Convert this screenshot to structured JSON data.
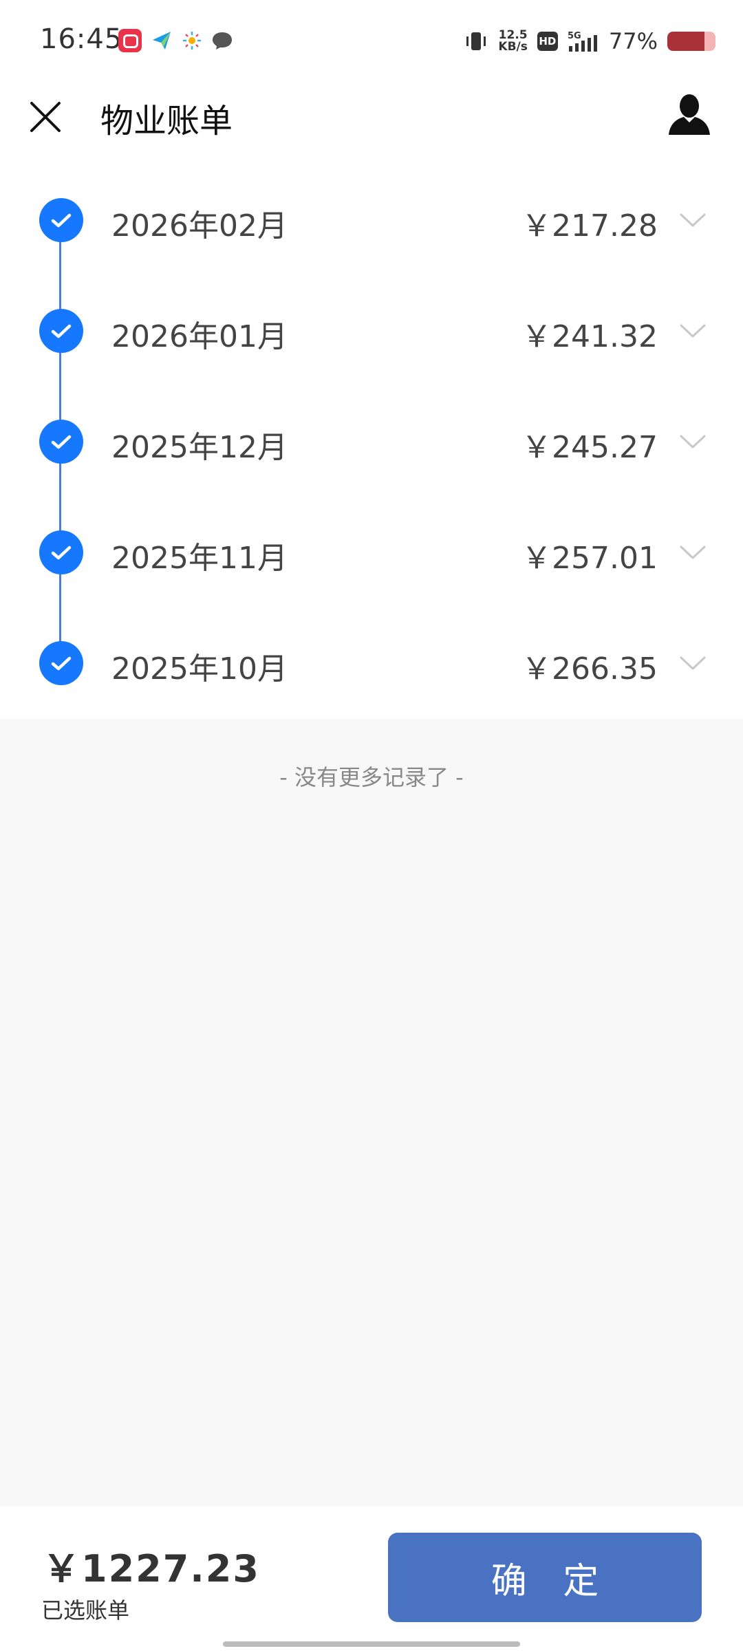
{
  "status_bar": {
    "time": "16:45",
    "net_speed_value": "12.5",
    "net_speed_unit": "KB/s",
    "hd_label": "HD",
    "network": "5G",
    "battery_text": "77%",
    "battery_level": 0.77
  },
  "header": {
    "title": "物业账单"
  },
  "bills": [
    {
      "month": "2026年02月",
      "amount": "￥217.28",
      "selected": true
    },
    {
      "month": "2026年01月",
      "amount": "￥241.32",
      "selected": true
    },
    {
      "month": "2025年12月",
      "amount": "￥245.27",
      "selected": true
    },
    {
      "month": "2025年11月",
      "amount": "￥257.01",
      "selected": true
    },
    {
      "month": "2025年10月",
      "amount": "￥266.35",
      "selected": true
    }
  ],
  "no_more_text": "- 没有更多记录了 -",
  "footer": {
    "total": "￥1227.23",
    "total_label": "已选账单",
    "confirm_label": "确 定"
  },
  "colors": {
    "accent": "#1677ff",
    "button": "#4a72c2",
    "timeline": "#4a7fd4"
  }
}
